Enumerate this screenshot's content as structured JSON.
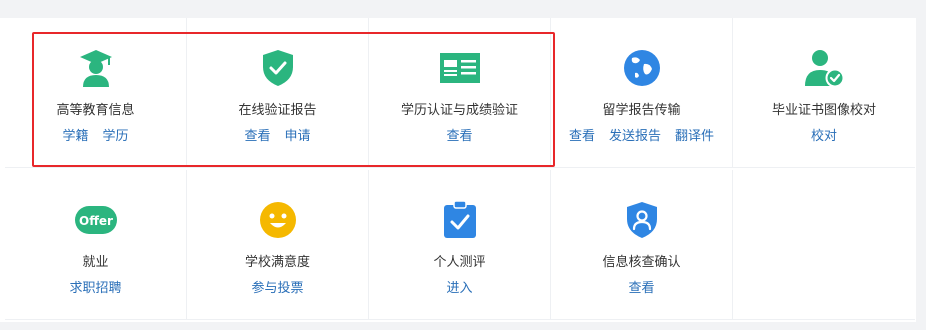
{
  "colors": {
    "green": "#2bb57f",
    "blue": "#2f86e3",
    "yellow": "#f5b800",
    "link": "#2a6fb8",
    "highlight": "#e8272a"
  },
  "services": [
    {
      "title": "高等教育信息",
      "icon": "graduation-cap-icon",
      "links": [
        "学籍",
        "学历"
      ]
    },
    {
      "title": "在线验证报告",
      "icon": "shield-check-icon",
      "links": [
        "查看",
        "申请"
      ]
    },
    {
      "title": "学历认证与成绩验证",
      "icon": "certificate-card-icon",
      "links": [
        "查看"
      ]
    },
    {
      "title": "留学报告传输",
      "icon": "globe-icon",
      "links": [
        "查看",
        "发送报告",
        "翻译件"
      ]
    },
    {
      "title": "毕业证书图像校对",
      "icon": "user-check-icon",
      "links": [
        "校对"
      ]
    },
    {
      "title": "就业",
      "icon": "offer-badge-icon",
      "links": [
        "求职招聘"
      ]
    },
    {
      "title": "学校满意度",
      "icon": "smiley-icon",
      "links": [
        "参与投票"
      ]
    },
    {
      "title": "个人测评",
      "icon": "clipboard-check-icon",
      "links": [
        "进入"
      ]
    },
    {
      "title": "信息核查确认",
      "icon": "shield-user-icon",
      "links": [
        "查看"
      ]
    }
  ],
  "offer_icon_text": "Offer"
}
